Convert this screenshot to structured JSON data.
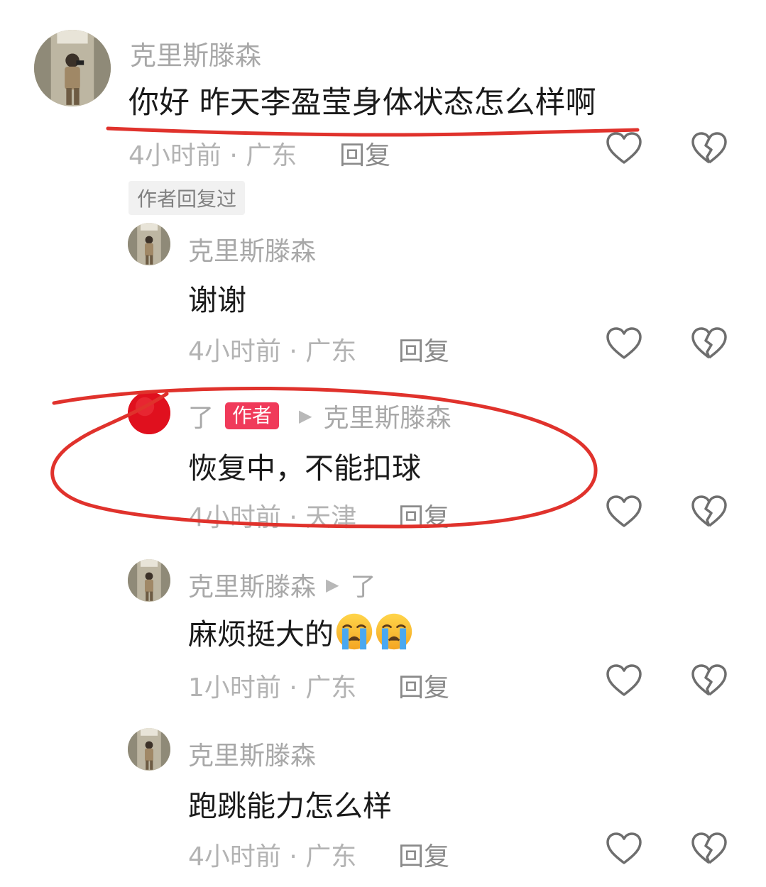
{
  "comments": [
    {
      "author": "克里斯滕森",
      "text": "你好 昨天李盈莹身体状态怎么样啊",
      "meta": "4小时前 · 广东",
      "reply_label": "回复",
      "badge": "作者回复过"
    },
    {
      "author": "克里斯滕森",
      "text": "谢谢",
      "meta": "4小时前 · 广东",
      "reply_label": "回复"
    },
    {
      "author": "了",
      "author_tag": "作者",
      "reply_to": "克里斯滕森",
      "text": "恢复中，不能扣球",
      "meta": "4小时前 · 天津",
      "reply_label": "回复",
      "avatar_color": "#e0101e"
    },
    {
      "author": "克里斯滕森",
      "reply_to": "了",
      "text": "麻烦挺大的",
      "emoji": [
        "loudly-crying-face",
        "loudly-crying-face"
      ],
      "meta": "1小时前 · 广东",
      "reply_label": "回复"
    },
    {
      "author": "克里斯滕森",
      "text": "跑跳能力怎么样",
      "meta": "4小时前 · 广东",
      "reply_label": "回复"
    }
  ],
  "icons": {
    "like": "heart-outline-icon",
    "dislike": "broken-heart-icon"
  },
  "colors": {
    "annotation": "#e0322c",
    "author_tag": "#f03a5a",
    "meta": "#b3b3b3"
  }
}
